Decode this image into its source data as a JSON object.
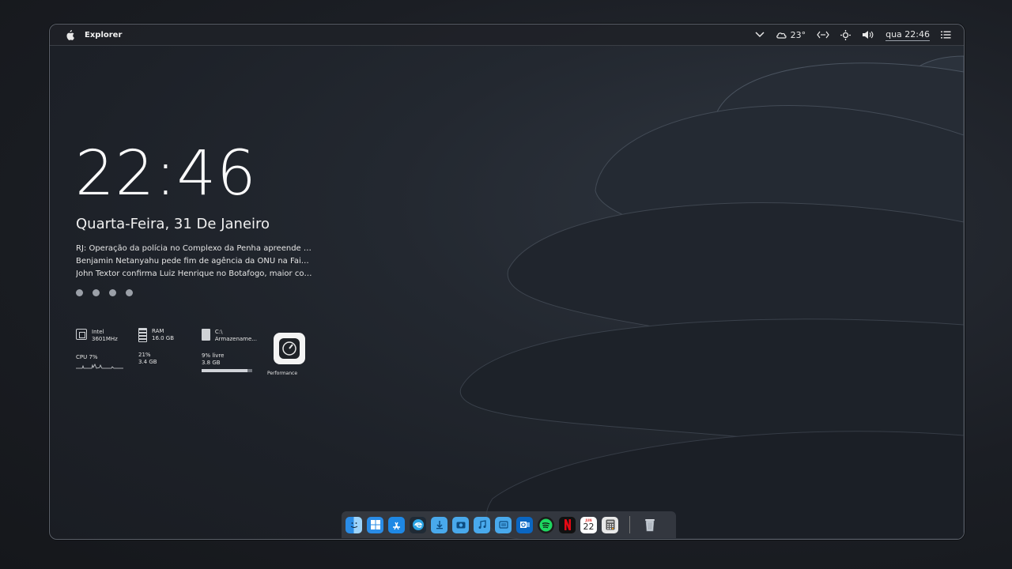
{
  "menubar": {
    "app_name": "Explorer",
    "weather": "23°",
    "clock": "qua 22:46"
  },
  "desktop": {
    "time": "22:46",
    "date": "Quarta-Feira, 31 De Janeiro",
    "news": [
      "RJ: Operação da polícia no Complexo da Penha apreende m...",
      "Benjamin Netanyahu pede fim de agência da ONU na Faixa...",
      "John Textor confirma Luiz Henrique no Botafogo, maior con..."
    ]
  },
  "widgets": {
    "cpu": {
      "name_line1": "Intel",
      "name_line2": "3601MHz",
      "usage": "CPU 7%"
    },
    "ram": {
      "title": "RAM",
      "total": "16.0 GB",
      "percent": "21%",
      "used": "3.4 GB"
    },
    "disk": {
      "path": "C:\\",
      "label": "Armazename...",
      "free": "9% livre",
      "size": "3.8 GB",
      "fill": 0.91
    },
    "performance": {
      "label": "Performance"
    }
  },
  "dock": {
    "icons": [
      "finder-icon",
      "start-icon",
      "app-store-icon",
      "edge-icon",
      "downloads-icon",
      "pictures-icon",
      "music-icon",
      "documents-icon",
      "outlook-icon",
      "spotify-icon",
      "netflix-icon",
      "calendar-icon",
      "calculator-icon",
      "trash-icon"
    ],
    "calendar_day": "22",
    "calendar_month": "JUN"
  }
}
